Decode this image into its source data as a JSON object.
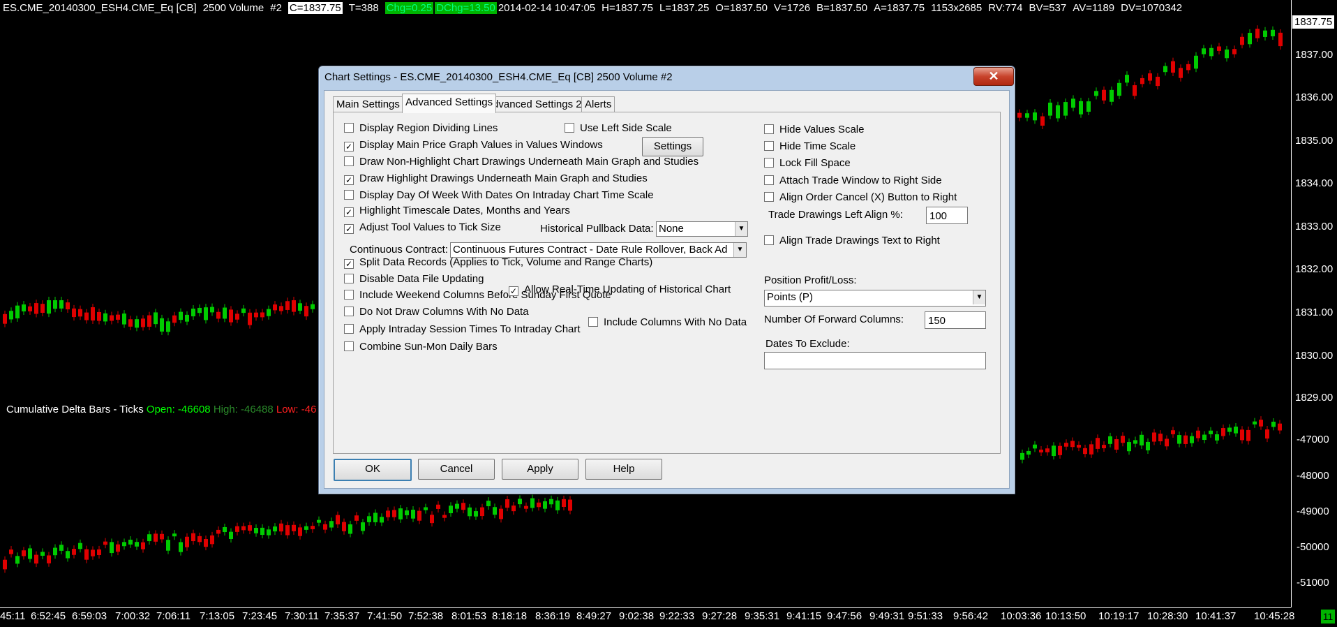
{
  "topbar": {
    "symbol": "ES.CME_20140300_ESH4.CME_Eq [CB]",
    "bar_type": "2500 Volume",
    "chart_num": "#2",
    "close": "C=1837.75",
    "trades": "T=388",
    "chg": "Chg=0.25",
    "dchg": "DChg=13.50",
    "datetime": "2014-02-14 10:47:05",
    "high": "H=1837.75",
    "low": "L=1837.25",
    "open": "O=1837.50",
    "volume": "V=1726",
    "bid": "B=1837.50",
    "ask": "A=1837.75",
    "size": "1153x2685",
    "rv": "RV:774",
    "bv": "BV=537",
    "av": "AV=1189",
    "dv": "DV=1070342"
  },
  "price_scale": {
    "current": "1837.75",
    "labels": [
      "1837.00",
      "1836.00",
      "1835.00",
      "1834.00",
      "1833.00",
      "1832.00",
      "1831.00",
      "1830.00",
      "1829.00"
    ],
    "delta_labels": [
      "-47000",
      "-48000",
      "-49000",
      "-50000",
      "-51000"
    ]
  },
  "time_scale": {
    "labels": [
      "45:11",
      "6:52:45",
      "6:59:03",
      "7:00:32",
      "7:06:11",
      "7:13:05",
      "7:23:45",
      "7:30:11",
      "7:35:37",
      "7:41:50",
      "7:52:38",
      "8:01:53",
      "8:18:18",
      "8:36:19",
      "8:49:27",
      "9:02:38",
      "9:22:33",
      "9:27:28",
      "9:35:31",
      "9:41:15",
      "9:47:56",
      "9:49:31",
      "9:51:33",
      "9:56:42",
      "10:03:36",
      "10:13:50",
      "10:19:17",
      "10:28:30",
      "10:41:37",
      "10:45:28"
    ],
    "corner": "11"
  },
  "study": {
    "name": "Cumulative Delta Bars - Ticks",
    "open": "Open: -46608",
    "high": "High: -46488",
    "low": "Low: -46"
  },
  "dialog": {
    "title": "Chart Settings - ES.CME_20140300_ESH4.CME_Eq [CB]  2500 Volume  #2",
    "close_glyph": "✕",
    "tabs": [
      "Main Settings",
      "Advanced Settings",
      "Advanced Settings 2",
      "Alerts"
    ],
    "left_options": [
      {
        "label": "Display Region Dividing Lines",
        "checked": false
      },
      {
        "label": "Display Main Price Graph Values in Values Windows",
        "checked": true
      },
      {
        "label": "Draw Non-Highlight Chart Drawings Underneath Main Graph and Studies",
        "checked": false
      },
      {
        "label": "Draw Highlight Drawings Underneath Main Graph and Studies",
        "checked": true
      },
      {
        "label": "Display Day Of Week With Dates On Intraday Chart Time Scale",
        "checked": false
      },
      {
        "label": "Highlight Timescale Dates, Months and Years",
        "checked": true
      },
      {
        "label": "Adjust Tool Values to Tick Size",
        "checked": true
      },
      {
        "label": "Split Data Records (Applies to Tick, Volume and Range Charts)",
        "checked": true
      },
      {
        "label": "Disable Data File Updating",
        "checked": false
      },
      {
        "label": "Include Weekend Columns Before Sunday First Quote",
        "checked": false
      },
      {
        "label": "Do Not Draw Columns With No Data",
        "checked": false
      },
      {
        "label": "Apply Intraday Session Times To Intraday Chart",
        "checked": false
      },
      {
        "label": "Combine Sun-Mon Daily Bars",
        "checked": false
      }
    ],
    "use_left_side_scale": {
      "label": "Use Left Side Scale",
      "checked": false
    },
    "settings_button": "Settings",
    "historical_pullback_label": "Historical Pullback Data:",
    "historical_pullback_value": "None",
    "continuous_contract_label": "Continuous Contract:",
    "continuous_contract_value": "Continuous Futures Contract - Date Rule Rollover, Back Ad",
    "allow_realtime": {
      "label": "Allow Real-Time Updating of Historical Chart",
      "checked": true
    },
    "include_columns_no_data": {
      "label": "Include Columns With No Data",
      "checked": false
    },
    "right_options": [
      {
        "label": "Hide Values Scale",
        "checked": false
      },
      {
        "label": "Hide Time Scale",
        "checked": false
      },
      {
        "label": "Lock Fill Space",
        "checked": false
      },
      {
        "label": "Attach Trade Window to Right Side",
        "checked": false
      },
      {
        "label": "Align Order Cancel (X) Button to Right",
        "checked": false
      }
    ],
    "trade_drawings_label": "Trade Drawings Left Align %:",
    "trade_drawings_value": "100",
    "align_trade_text": {
      "label": "Align Trade Drawings Text to Right",
      "checked": false
    },
    "position_pl_label": "Position Profit/Loss:",
    "position_pl_value": "Points (P)",
    "forward_columns_label": "Number Of Forward Columns:",
    "forward_columns_value": "150",
    "dates_exclude_label": "Dates To Exclude:",
    "dates_exclude_value": "",
    "buttons": {
      "ok": "OK",
      "cancel": "Cancel",
      "apply": "Apply",
      "help": "Help"
    }
  },
  "colors": {
    "up": "#00cc00",
    "down": "#e00000",
    "background": "#000000",
    "dialog_frame": "#b9cfe8"
  }
}
